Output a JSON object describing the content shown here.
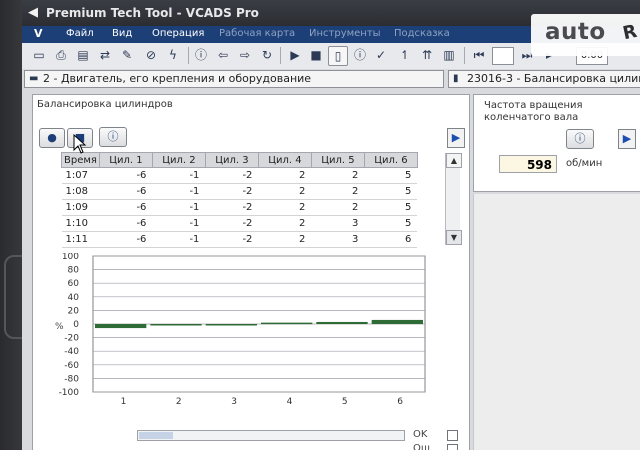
{
  "window": {
    "title": "Premium Tech Tool - VCADS Pro"
  },
  "menu": {
    "items": [
      "Файл",
      "Вид",
      "Операция",
      "Рабочая карта",
      "Инструменты",
      "Подсказка"
    ]
  },
  "toolbar": {
    "field_value": "0.00"
  },
  "path": {
    "left": "2 - Двигатель, его крепления и оборудование",
    "right": "23016-3 - Балансировка цилин"
  },
  "left_panel": {
    "title": "Балансировка цилиндров",
    "table": {
      "columns": [
        "Время",
        "Цил. 1",
        "Цил. 2",
        "Цил. 3",
        "Цил. 4",
        "Цил. 5",
        "Цил. 6"
      ],
      "rows": [
        [
          "1:07",
          "-6",
          "-1",
          "-2",
          "2",
          "2",
          "5"
        ],
        [
          "1:08",
          "-6",
          "-1",
          "-2",
          "2",
          "2",
          "5"
        ],
        [
          "1:09",
          "-6",
          "-1",
          "-2",
          "2",
          "2",
          "5"
        ],
        [
          "1:10",
          "-6",
          "-1",
          "-2",
          "2",
          "3",
          "5"
        ],
        [
          "1:11",
          "-6",
          "-1",
          "-2",
          "2",
          "3",
          "6"
        ]
      ]
    },
    "status_ok": "OK",
    "status_err": "Ош"
  },
  "right_panel": {
    "title": "Частота вращения коленчатого вала",
    "rpm_value": "598",
    "rpm_unit": "об/мин"
  },
  "chart_data": {
    "type": "bar",
    "categories": [
      "1",
      "2",
      "3",
      "4",
      "5",
      "6"
    ],
    "values": [
      -6,
      -1,
      -2,
      2,
      3,
      6
    ],
    "ylim": [
      -100,
      100
    ],
    "yticks": [
      "100",
      "80",
      "60",
      "40",
      "20",
      "0",
      "-20",
      "-40",
      "-60",
      "-80",
      "-100"
    ],
    "ylabel": "%",
    "grid": true,
    "bar_color": "#2f6b35"
  },
  "watermark": {
    "text": "auto",
    "suffix": "R"
  },
  "colors": {
    "menu_bg": "#1d3f77",
    "accent": "#1d4fb0"
  }
}
